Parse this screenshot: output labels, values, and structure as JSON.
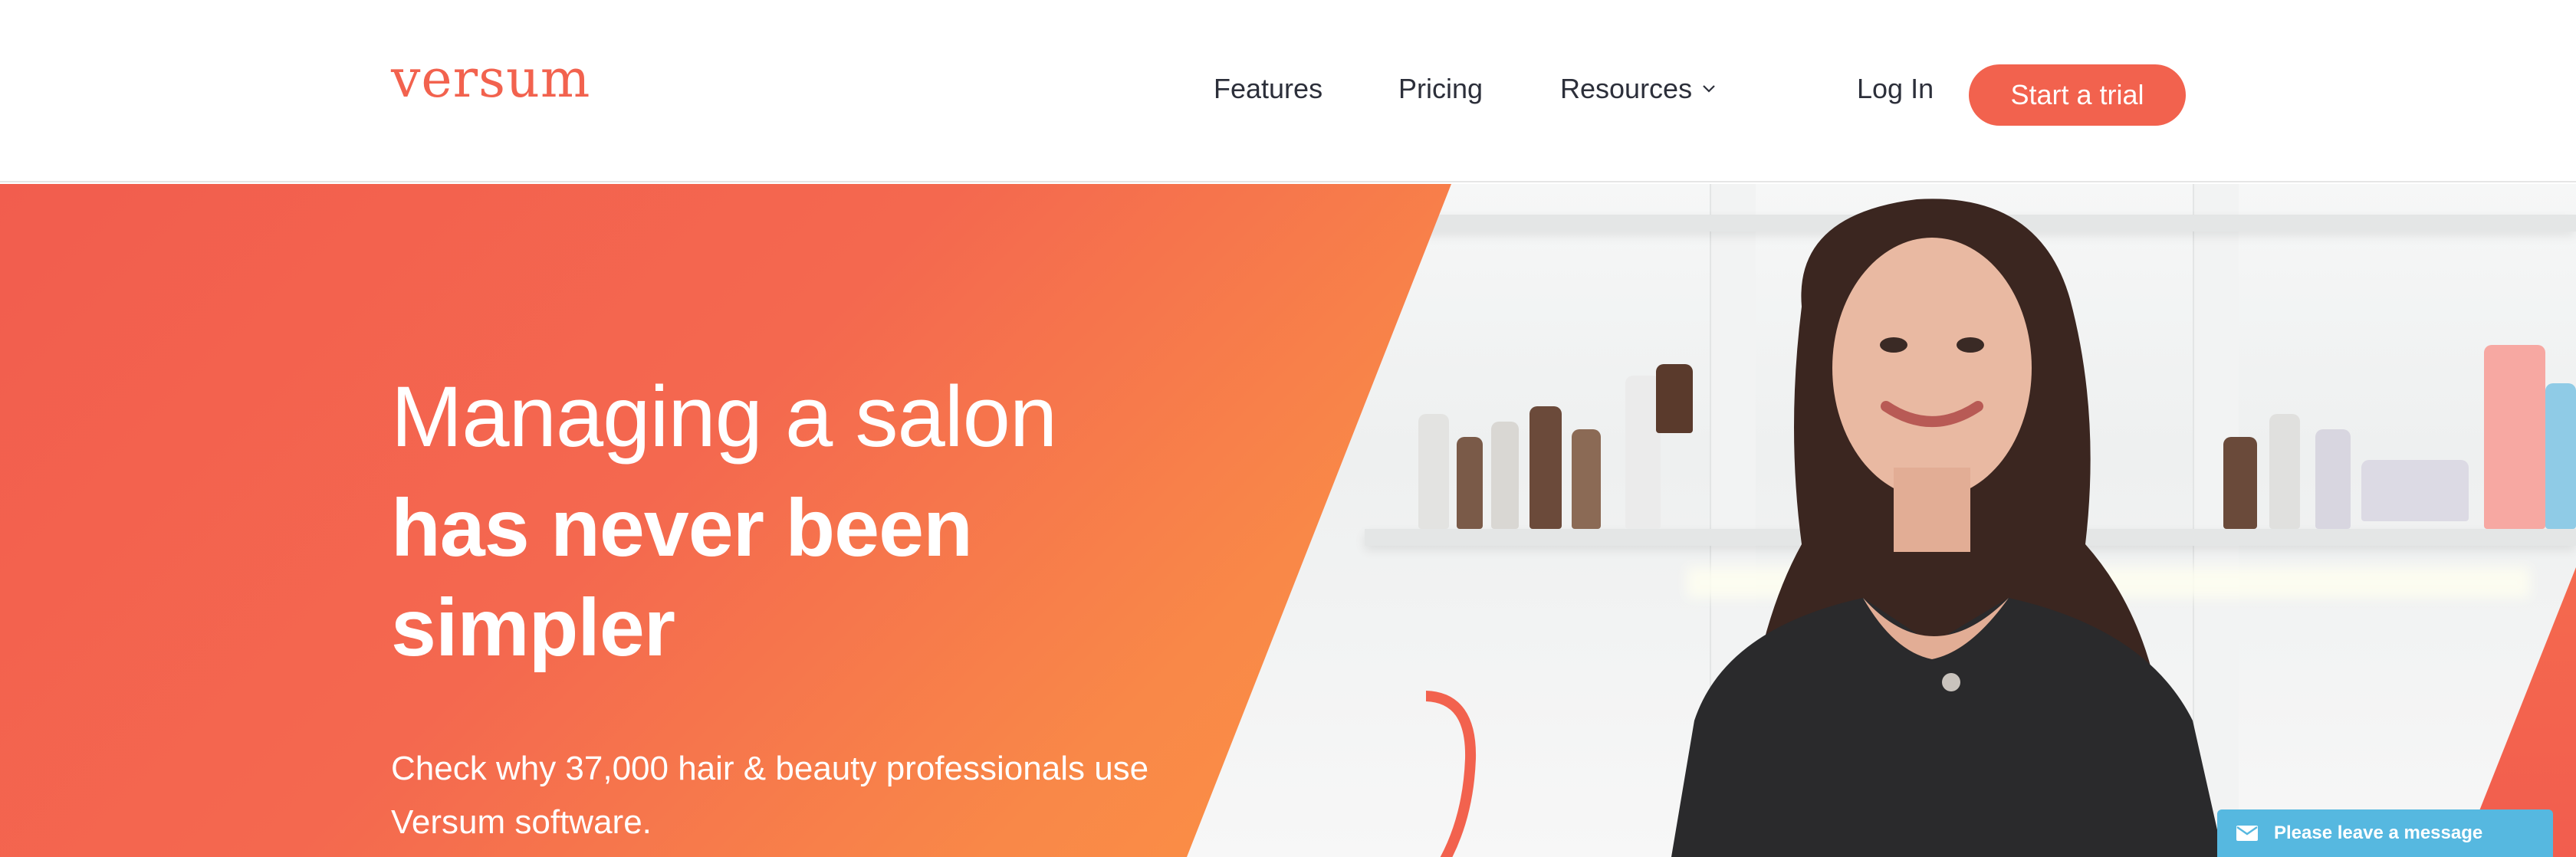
{
  "header": {
    "logo": "versum",
    "nav": {
      "features": "Features",
      "pricing": "Pricing",
      "resources": "Resources",
      "login": "Log In"
    },
    "cta": "Start a trial"
  },
  "hero": {
    "title_line1": "Managing a salon",
    "title_bold": "has never been simpler",
    "subtitle": "Check why 37,000 hair & beauty professionals use Versum software."
  },
  "chat_widget": {
    "label": "Please leave a message",
    "icon": "envelope-icon"
  },
  "colors": {
    "brand": "#f2624e",
    "hero_gradient_end": "#fb9244",
    "chat": "#56b8e0",
    "nav_text": "#2c2f3a"
  }
}
